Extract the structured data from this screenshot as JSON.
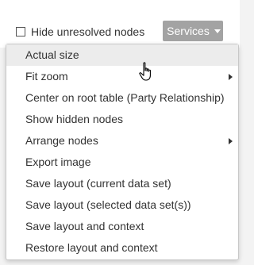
{
  "toolbar": {
    "hide_unresolved_label": "Hide unresolved nodes",
    "hide_unresolved_checked": false,
    "services_label": "Services",
    "services_icon": "caret-down-icon"
  },
  "menu": {
    "items": [
      {
        "label": "Actual size",
        "has_submenu": false,
        "highlighted": true
      },
      {
        "label": "Fit zoom",
        "has_submenu": true
      },
      {
        "label": "Center on root table (Party Relationship)",
        "has_submenu": false
      },
      {
        "label": "Show hidden nodes",
        "has_submenu": false
      },
      {
        "label": "Arrange nodes",
        "has_submenu": true
      },
      {
        "label": "Export image",
        "has_submenu": false
      },
      {
        "label": "Save layout (current data set)",
        "has_submenu": false
      },
      {
        "label": "Save layout (selected data set(s))",
        "has_submenu": false
      },
      {
        "label": "Save layout and context",
        "has_submenu": false
      },
      {
        "label": "Restore layout and context",
        "has_submenu": false
      }
    ]
  },
  "colors": {
    "services_button_bg": "#a3a3a3",
    "menu_highlight_bg": "#ececec",
    "text": "#333333"
  },
  "cursor": {
    "icon": "hand-pointer-icon"
  }
}
